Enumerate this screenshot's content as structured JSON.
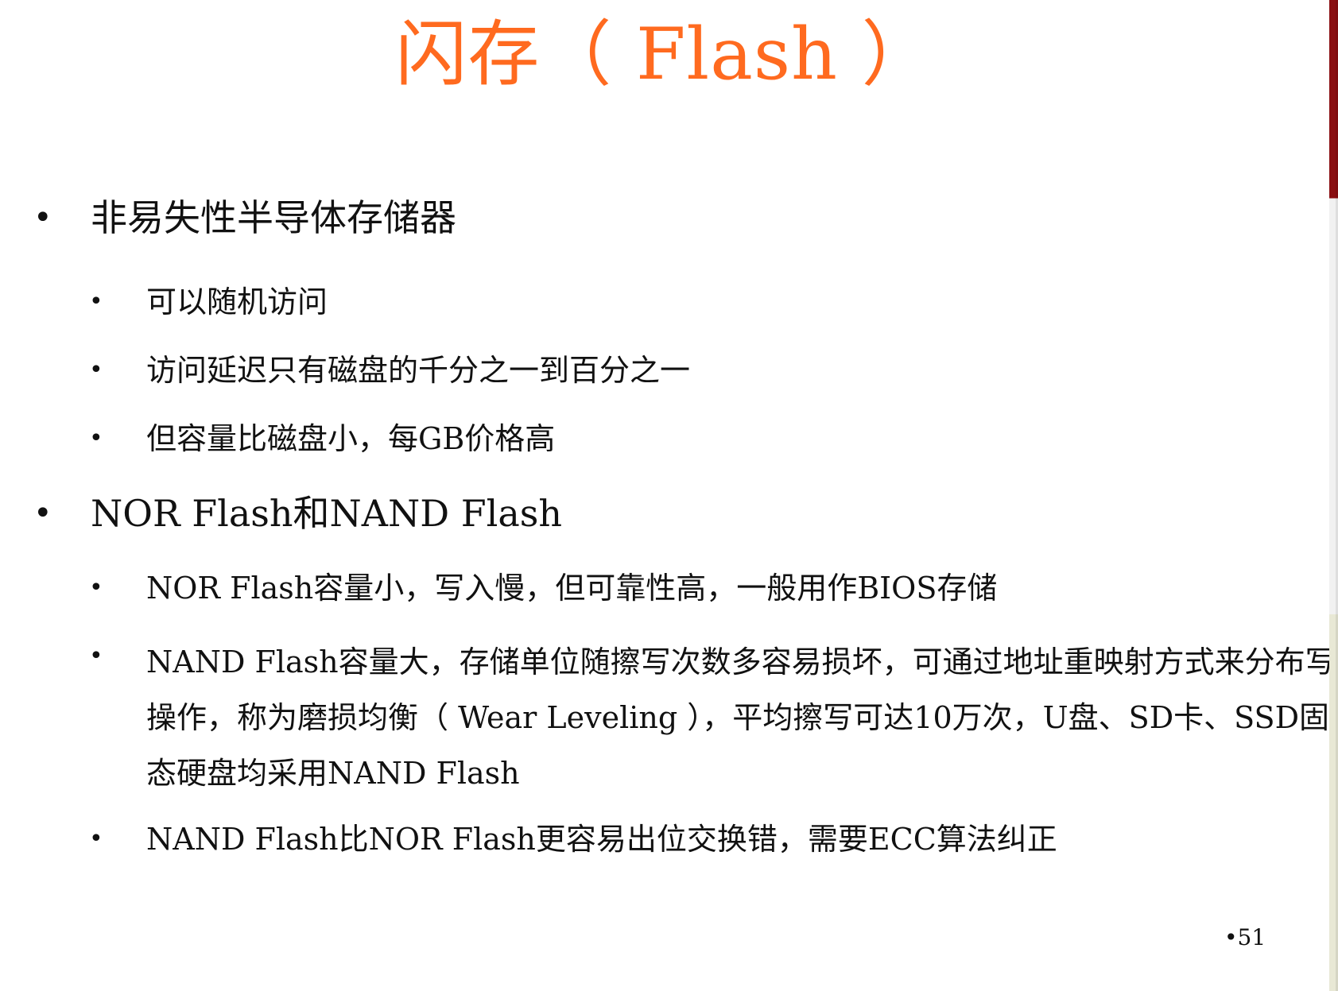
{
  "slide": {
    "title": "闪存（ Flash ）",
    "page_number": "•51"
  },
  "sections": [
    {
      "bullet": "•",
      "text": "非易失性半导体存储器",
      "items": [
        {
          "bullet": "•",
          "text": "可以随机访问"
        },
        {
          "bullet": "•",
          "text": "访问延迟只有磁盘的千分之一到百分之一"
        },
        {
          "bullet": "•",
          "text": "但容量比磁盘小，每GB价格高"
        }
      ]
    },
    {
      "bullet": "•",
      "text": "NOR Flash和NAND Flash",
      "items": [
        {
          "bullet": "•",
          "text": "NOR Flash容量小，写入慢，但可靠性高，一般用作BIOS存储"
        },
        {
          "bullet": "•",
          "text": "NAND Flash容量大，存储单位随擦写次数多容易损坏，可通过地址重映射方式来分布写操作，称为磨损均衡（ Wear Leveling ），平均擦写可达10万次，U盘、SD卡、SSD固态硬盘均采用NAND Flash"
        },
        {
          "bullet": "•",
          "text": "NAND Flash比NOR Flash更容易出位交换错，需要ECC算法纠正"
        }
      ]
    }
  ],
  "colors": {
    "title": "#ff6a1f",
    "text": "#111111",
    "edge_accent": "#8a0f12"
  }
}
